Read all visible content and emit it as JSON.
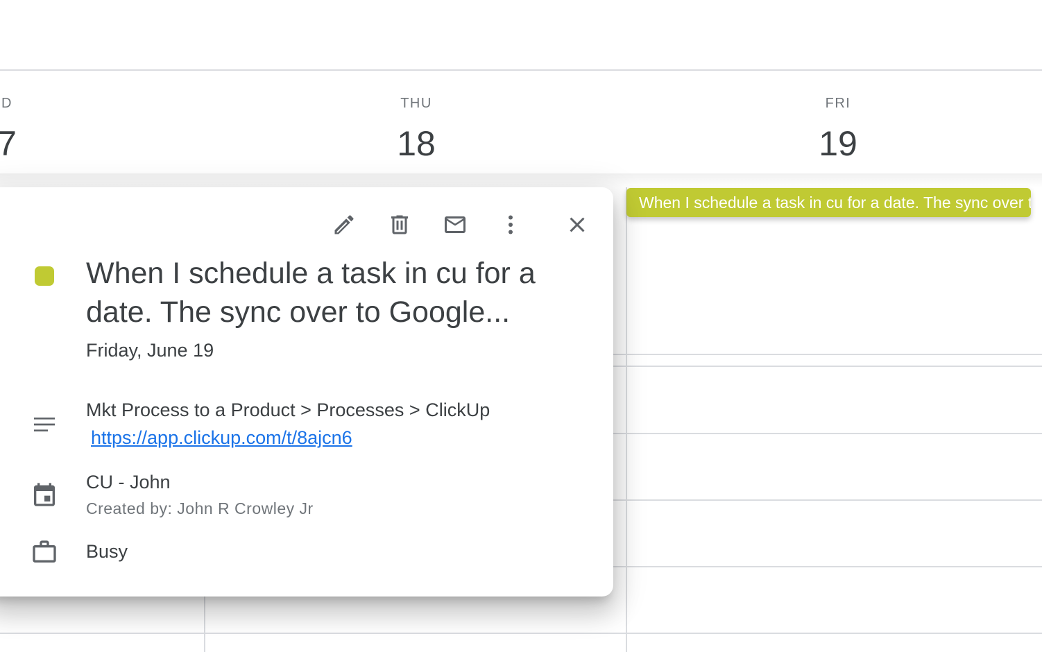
{
  "days": [
    {
      "dow": "D",
      "num": "7"
    },
    {
      "dow": "THU",
      "num": "18"
    },
    {
      "dow": "FRI",
      "num": "19"
    }
  ],
  "event_chip": {
    "label": "When I schedule a task in cu for a date. The sync over to Google...",
    "color": "#c0ca33"
  },
  "popup": {
    "toolbar": {
      "edit": "edit-icon",
      "delete": "delete-icon",
      "email": "email-icon",
      "more": "more-vert-icon",
      "close": "close-icon"
    },
    "title": "When I schedule a task in cu for a date. The sync over to Google...",
    "date": "Friday, June 19",
    "description": {
      "path": "Mkt Process to a Product > Processes > ClickUp",
      "link": "https://app.clickup.com/t/8ajcn6"
    },
    "calendar": {
      "name": "CU - John",
      "creator": "Created by: John R Crowley Jr"
    },
    "availability": "Busy",
    "accent_color": "#c0ca33"
  }
}
